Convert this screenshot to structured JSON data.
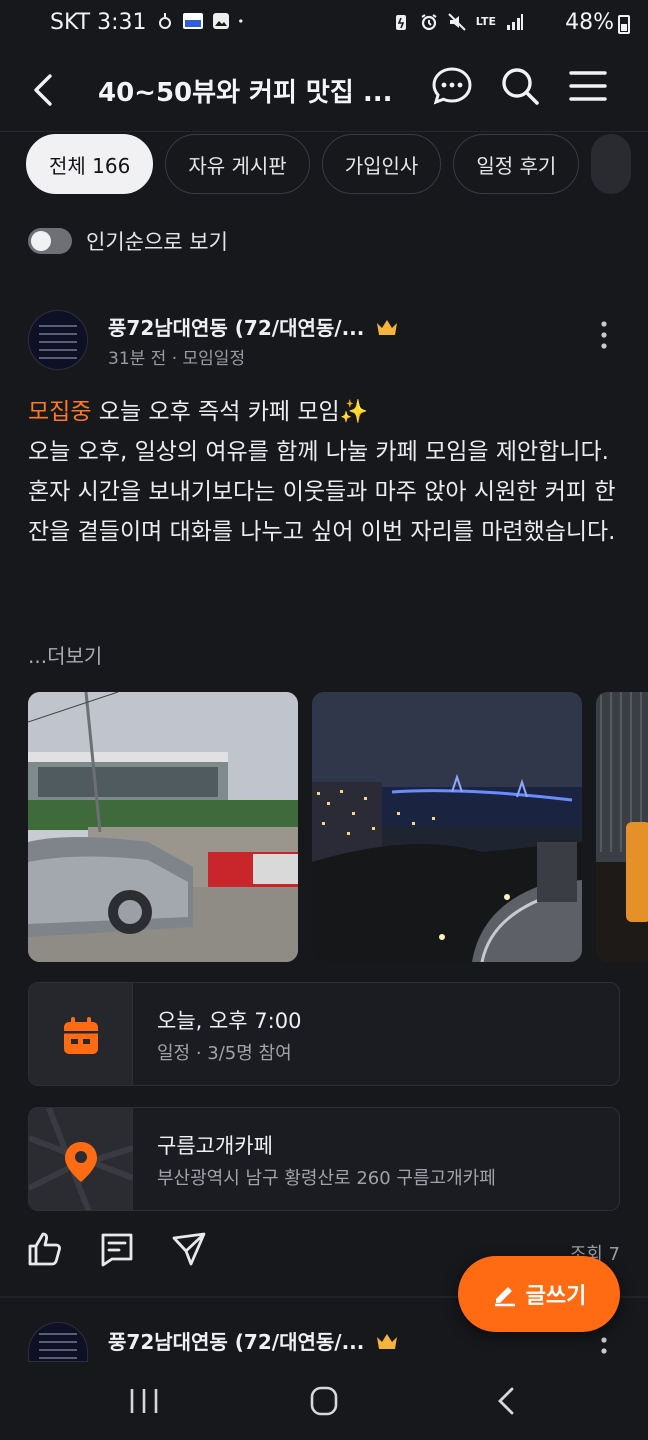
{
  "status_bar": {
    "time": "SKT 3:31",
    "battery": "48%",
    "network": "LTE"
  },
  "header": {
    "title": "40~50뷰와 커피 맛집 ...",
    "icons": [
      "back-arrow-icon",
      "chat-icon",
      "search-icon",
      "menu-icon"
    ]
  },
  "tabs": [
    {
      "label": "전체 166",
      "active": true
    },
    {
      "label": "자유 게시판",
      "active": false
    },
    {
      "label": "가입인사",
      "active": false
    },
    {
      "label": "일정 후기",
      "active": false
    }
  ],
  "sort_toggle": {
    "label": "인기순으로 보기",
    "on": false
  },
  "post": {
    "author": "풍72남대연동 (72/대연동/...",
    "meta": "31분 전 · 모임일정",
    "badge": "모집중",
    "headline": " 오늘 오후 즉석 카페 모임✨",
    "body": "오늘 오후, 일상의 여유를 함께 나눌 카페 모임을 제안합니다. 혼자 시간을 보내기보다는 이웃들과 마주 앉아 시원한 커피 한 잔을 곁들이며 대화를 나누고 싶어 이번 자리를 마련했습니다.",
    "more_label": "...더보기",
    "photos": [
      "cafe-exterior-photo",
      "night-city-view-photo",
      "cafe-interior-photo"
    ],
    "schedule": {
      "title": "오늘, 오후 7:00",
      "detail": "일정 · 3/5명 참여"
    },
    "location": {
      "title": "구름고개카페",
      "detail": "부산광역시 남구 황령산로 260 구름고개카페"
    },
    "views": "조회 7"
  },
  "write_button": {
    "label": "글쓰기"
  },
  "next_post": {
    "author": "풍72남대연동 (72/대연동/..."
  },
  "colors": {
    "accent": "#ff6b13",
    "background": "#17181c"
  }
}
